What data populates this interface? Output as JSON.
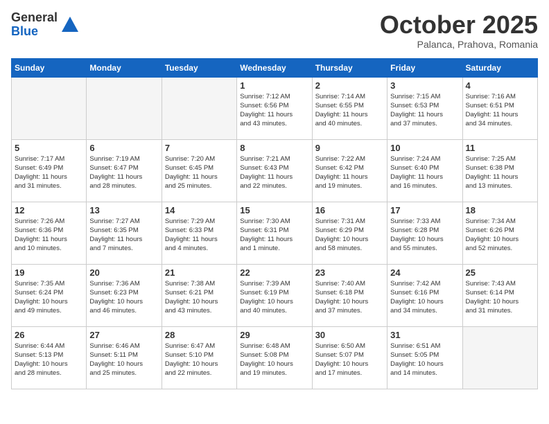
{
  "header": {
    "logo_general": "General",
    "logo_blue": "Blue",
    "month": "October 2025",
    "location": "Palanca, Prahova, Romania"
  },
  "weekdays": [
    "Sunday",
    "Monday",
    "Tuesday",
    "Wednesday",
    "Thursday",
    "Friday",
    "Saturday"
  ],
  "weeks": [
    [
      {
        "day": "",
        "info": "",
        "empty": true
      },
      {
        "day": "",
        "info": "",
        "empty": true
      },
      {
        "day": "",
        "info": "",
        "empty": true
      },
      {
        "day": "1",
        "info": "Sunrise: 7:12 AM\nSunset: 6:56 PM\nDaylight: 11 hours\nand 43 minutes.",
        "empty": false
      },
      {
        "day": "2",
        "info": "Sunrise: 7:14 AM\nSunset: 6:55 PM\nDaylight: 11 hours\nand 40 minutes.",
        "empty": false
      },
      {
        "day": "3",
        "info": "Sunrise: 7:15 AM\nSunset: 6:53 PM\nDaylight: 11 hours\nand 37 minutes.",
        "empty": false
      },
      {
        "day": "4",
        "info": "Sunrise: 7:16 AM\nSunset: 6:51 PM\nDaylight: 11 hours\nand 34 minutes.",
        "empty": false
      }
    ],
    [
      {
        "day": "5",
        "info": "Sunrise: 7:17 AM\nSunset: 6:49 PM\nDaylight: 11 hours\nand 31 minutes.",
        "empty": false
      },
      {
        "day": "6",
        "info": "Sunrise: 7:19 AM\nSunset: 6:47 PM\nDaylight: 11 hours\nand 28 minutes.",
        "empty": false
      },
      {
        "day": "7",
        "info": "Sunrise: 7:20 AM\nSunset: 6:45 PM\nDaylight: 11 hours\nand 25 minutes.",
        "empty": false
      },
      {
        "day": "8",
        "info": "Sunrise: 7:21 AM\nSunset: 6:43 PM\nDaylight: 11 hours\nand 22 minutes.",
        "empty": false
      },
      {
        "day": "9",
        "info": "Sunrise: 7:22 AM\nSunset: 6:42 PM\nDaylight: 11 hours\nand 19 minutes.",
        "empty": false
      },
      {
        "day": "10",
        "info": "Sunrise: 7:24 AM\nSunset: 6:40 PM\nDaylight: 11 hours\nand 16 minutes.",
        "empty": false
      },
      {
        "day": "11",
        "info": "Sunrise: 7:25 AM\nSunset: 6:38 PM\nDaylight: 11 hours\nand 13 minutes.",
        "empty": false
      }
    ],
    [
      {
        "day": "12",
        "info": "Sunrise: 7:26 AM\nSunset: 6:36 PM\nDaylight: 11 hours\nand 10 minutes.",
        "empty": false
      },
      {
        "day": "13",
        "info": "Sunrise: 7:27 AM\nSunset: 6:35 PM\nDaylight: 11 hours\nand 7 minutes.",
        "empty": false
      },
      {
        "day": "14",
        "info": "Sunrise: 7:29 AM\nSunset: 6:33 PM\nDaylight: 11 hours\nand 4 minutes.",
        "empty": false
      },
      {
        "day": "15",
        "info": "Sunrise: 7:30 AM\nSunset: 6:31 PM\nDaylight: 11 hours\nand 1 minute.",
        "empty": false
      },
      {
        "day": "16",
        "info": "Sunrise: 7:31 AM\nSunset: 6:29 PM\nDaylight: 10 hours\nand 58 minutes.",
        "empty": false
      },
      {
        "day": "17",
        "info": "Sunrise: 7:33 AM\nSunset: 6:28 PM\nDaylight: 10 hours\nand 55 minutes.",
        "empty": false
      },
      {
        "day": "18",
        "info": "Sunrise: 7:34 AM\nSunset: 6:26 PM\nDaylight: 10 hours\nand 52 minutes.",
        "empty": false
      }
    ],
    [
      {
        "day": "19",
        "info": "Sunrise: 7:35 AM\nSunset: 6:24 PM\nDaylight: 10 hours\nand 49 minutes.",
        "empty": false
      },
      {
        "day": "20",
        "info": "Sunrise: 7:36 AM\nSunset: 6:23 PM\nDaylight: 10 hours\nand 46 minutes.",
        "empty": false
      },
      {
        "day": "21",
        "info": "Sunrise: 7:38 AM\nSunset: 6:21 PM\nDaylight: 10 hours\nand 43 minutes.",
        "empty": false
      },
      {
        "day": "22",
        "info": "Sunrise: 7:39 AM\nSunset: 6:19 PM\nDaylight: 10 hours\nand 40 minutes.",
        "empty": false
      },
      {
        "day": "23",
        "info": "Sunrise: 7:40 AM\nSunset: 6:18 PM\nDaylight: 10 hours\nand 37 minutes.",
        "empty": false
      },
      {
        "day": "24",
        "info": "Sunrise: 7:42 AM\nSunset: 6:16 PM\nDaylight: 10 hours\nand 34 minutes.",
        "empty": false
      },
      {
        "day": "25",
        "info": "Sunrise: 7:43 AM\nSunset: 6:14 PM\nDaylight: 10 hours\nand 31 minutes.",
        "empty": false
      }
    ],
    [
      {
        "day": "26",
        "info": "Sunrise: 6:44 AM\nSunset: 5:13 PM\nDaylight: 10 hours\nand 28 minutes.",
        "empty": false
      },
      {
        "day": "27",
        "info": "Sunrise: 6:46 AM\nSunset: 5:11 PM\nDaylight: 10 hours\nand 25 minutes.",
        "empty": false
      },
      {
        "day": "28",
        "info": "Sunrise: 6:47 AM\nSunset: 5:10 PM\nDaylight: 10 hours\nand 22 minutes.",
        "empty": false
      },
      {
        "day": "29",
        "info": "Sunrise: 6:48 AM\nSunset: 5:08 PM\nDaylight: 10 hours\nand 19 minutes.",
        "empty": false
      },
      {
        "day": "30",
        "info": "Sunrise: 6:50 AM\nSunset: 5:07 PM\nDaylight: 10 hours\nand 17 minutes.",
        "empty": false
      },
      {
        "day": "31",
        "info": "Sunrise: 6:51 AM\nSunset: 5:05 PM\nDaylight: 10 hours\nand 14 minutes.",
        "empty": false
      },
      {
        "day": "",
        "info": "",
        "empty": true
      }
    ]
  ]
}
